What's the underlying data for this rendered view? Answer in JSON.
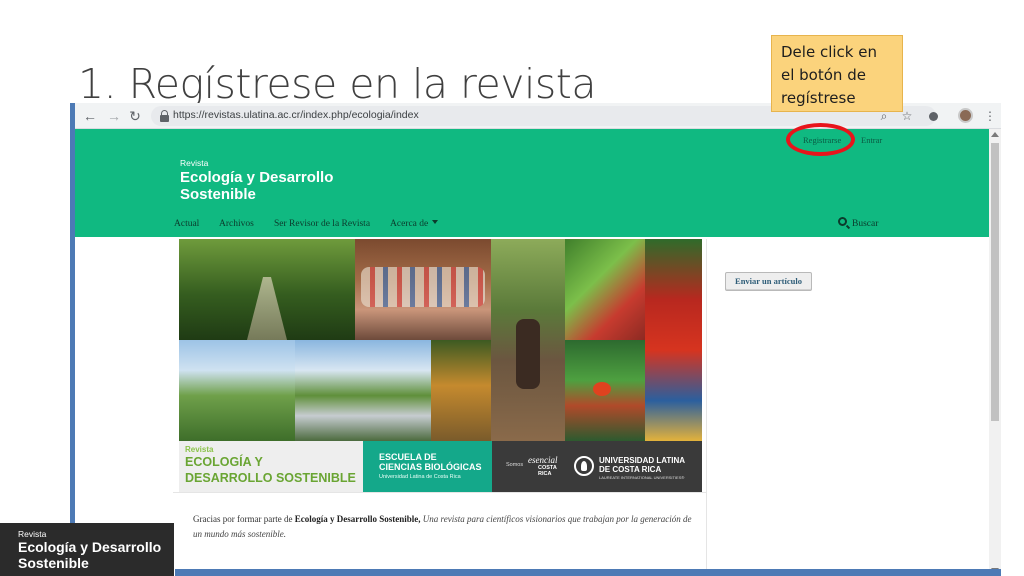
{
  "slide": {
    "title": "1. Regístrese en la revista",
    "callout": "Dele click en el botón de regístrese"
  },
  "browser": {
    "url": "https://revistas.ulatina.ac.cr/index.php/ecologia/index",
    "icons": {
      "back": "back-arrow-icon",
      "forward": "forward-arrow-icon",
      "reload": "reload-icon",
      "lock": "lock-icon",
      "zoom": "zoom-icon",
      "bookmark": "star-icon",
      "extension": "extension-icon",
      "profile": "profile-avatar",
      "menu": "kebab-menu-icon"
    }
  },
  "site": {
    "user_nav": {
      "register": "Registrarse",
      "login": "Entrar"
    },
    "logo": {
      "small": "Revista",
      "line1": "Ecología y Desarrollo",
      "line2": "Sostenible"
    },
    "nav": [
      "Actual",
      "Archivos",
      "Ser Revisor de la Revista",
      "Acerca de"
    ],
    "search_label": "Buscar",
    "header_color": "#10b981"
  },
  "banner": {
    "journal_small": "Revista",
    "journal_line1": "ECOLOGÍA Y",
    "journal_line2": "DESARROLLO SOSTENIBLE",
    "school_line1": "ESCUELA DE",
    "school_line2": "CIENCIAS BIOLÓGICAS",
    "school_sub": "Universidad Latina de Costa Rica",
    "somos": "Somos",
    "esencial": "esencial",
    "costa": "COSTA",
    "rica": "RICA",
    "ulatina_line1": "UNIVERSIDAD LATINA",
    "ulatina_line2": "DE COSTA RICA",
    "ulatina_sub": "LAUREATE INTERNATIONAL UNIVERSITIES®"
  },
  "sidebar": {
    "submit_button": "Enviar un artículo"
  },
  "about": {
    "lead": "Gracias por formar parte de ",
    "journal_name": "Ecología y Desarrollo Sostenible",
    "separator": ", ",
    "tagline": "Una revista para científicos visionarios que trabajan por la generación de un mundo más sostenible."
  },
  "corner_logo": {
    "small": "Revista",
    "line1": "Ecología y Desarrollo",
    "line2": "Sostenible"
  },
  "colors": {
    "callout_bg": "#fbd37c",
    "highlight_circle": "#e8141b",
    "accent_bar": "#4d7ab5"
  }
}
